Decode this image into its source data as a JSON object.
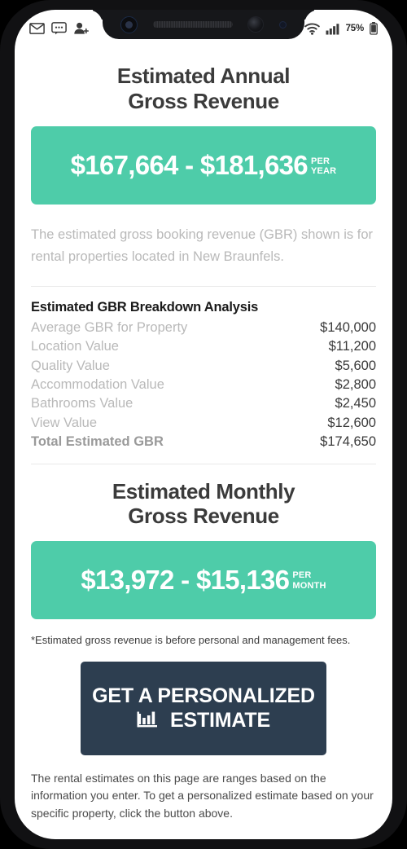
{
  "status_bar": {
    "left_icons": [
      "envelope-icon",
      "chat-bubble-icon",
      "add-person-icon"
    ],
    "right_icons": [
      "wifi-icon",
      "cellular-signal-icon",
      "battery-icon"
    ],
    "battery_percent": "75%"
  },
  "notch": {
    "elements": [
      "proximity-sensor",
      "earpiece-speaker",
      "front-camera",
      "light-sensor"
    ]
  },
  "annual": {
    "heading_line1": "Estimated Annual",
    "heading_line2": "Gross Revenue",
    "amount_range": "$167,664 - $181,636",
    "unit_line1": "PER",
    "unit_line2": "YEAR"
  },
  "description": "The estimated gross booking revenue (GBR) shown is for rental properties located in New Braunfels.",
  "breakdown": {
    "title": "Estimated GBR Breakdown Analysis",
    "rows": [
      {
        "label": "Average GBR for Property",
        "value": "$140,000"
      },
      {
        "label": "Location Value",
        "value": "$11,200"
      },
      {
        "label": "Quality Value",
        "value": "$5,600"
      },
      {
        "label": "Accommodation Value",
        "value": "$2,800"
      },
      {
        "label": "Bathrooms Value",
        "value": "$2,450"
      },
      {
        "label": "View Value",
        "value": "$12,600"
      }
    ],
    "total": {
      "label": "Total Estimated GBR",
      "value": "$174,650"
    }
  },
  "monthly": {
    "heading_line1": "Estimated Monthly",
    "heading_line2": "Gross Revenue",
    "amount_range": "$13,972 - $15,136",
    "unit_line1": "PER",
    "unit_line2": "MONTH"
  },
  "footnote": "*Estimated gross revenue is before personal and management fees.",
  "cta": {
    "line1": "GET A PERSONALIZED",
    "line2": "ESTIMATE",
    "icon": "bar-chart-icon"
  },
  "disclaimer": "The rental estimates on this page are ranges based on the information you enter. To get a personalized estimate based on your specific property, click the button above.",
  "colors": {
    "accent_teal": "#4ECCA9",
    "cta_navy": "#2D3E50",
    "heading_gray": "#3b3b3b",
    "muted_gray": "#b9b9b9"
  }
}
